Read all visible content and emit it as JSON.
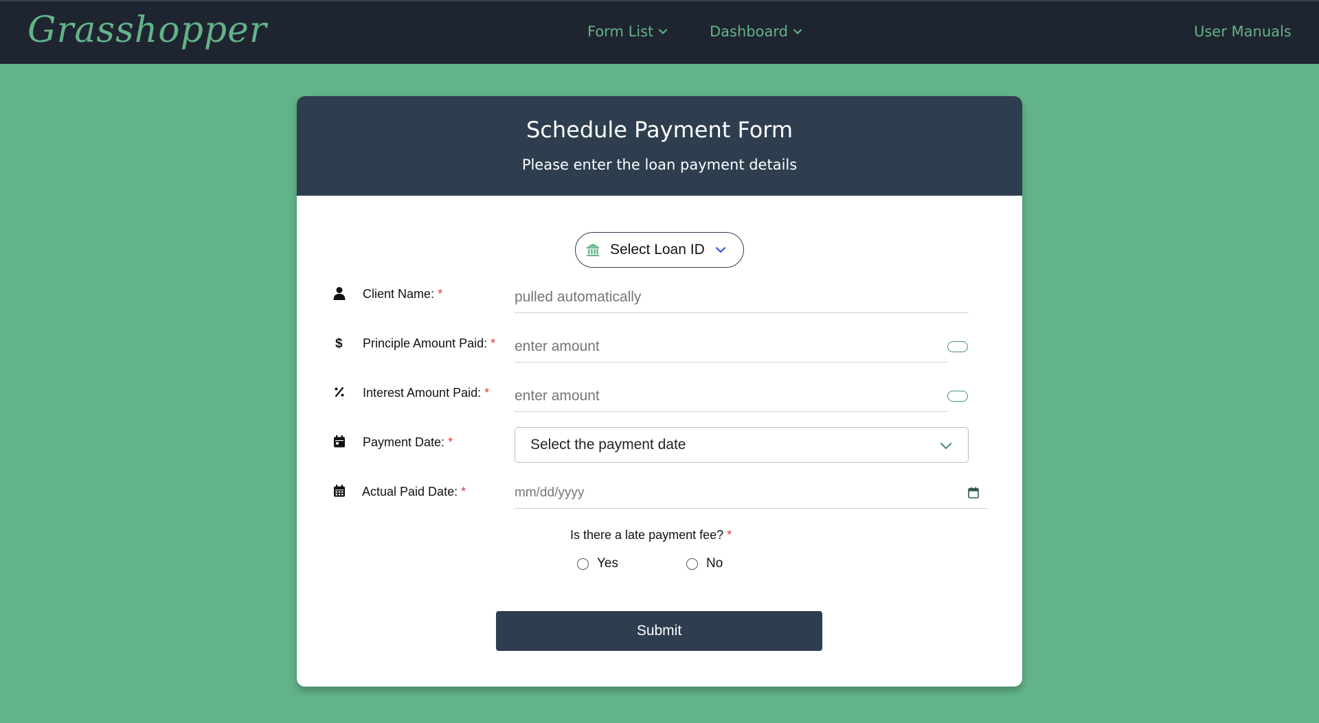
{
  "nav": {
    "logo": "Grasshopper",
    "form_list": "Form List",
    "dashboard": "Dashboard",
    "user_manuals": "User Manuals"
  },
  "form": {
    "title": "Schedule Payment Form",
    "subtitle": "Please enter the loan payment details",
    "loan_select_label": "Select Loan ID",
    "fields": {
      "client_name": {
        "label": "Client Name:",
        "placeholder": "pulled automatically"
      },
      "principal": {
        "label": "Principle Amount Paid:",
        "placeholder": "enter amount"
      },
      "interest": {
        "label": "Interest Amount Paid:",
        "placeholder": "enter amount"
      },
      "payment_date": {
        "label": "Payment Date:",
        "value": "Select the payment date"
      },
      "actual_paid_date": {
        "label": "Actual Paid Date:",
        "placeholder": "mm/dd/yyyy"
      }
    },
    "required_mark": "*",
    "late_fee_question": "Is there a late payment fee?",
    "late_fee_options": [
      "Yes",
      "No"
    ],
    "submit_label": "Submit"
  },
  "colors": {
    "accent": "#62b389",
    "navbar": "#1f2530",
    "header": "#2e3e4f",
    "required": "#e33333"
  },
  "icons": {
    "client_name": "user-icon",
    "principal": "dollar-icon",
    "interest": "percent-icon",
    "payment_date": "calendar-icon",
    "actual_paid_date": "calendar-grid-icon",
    "loan": "bank-icon"
  }
}
